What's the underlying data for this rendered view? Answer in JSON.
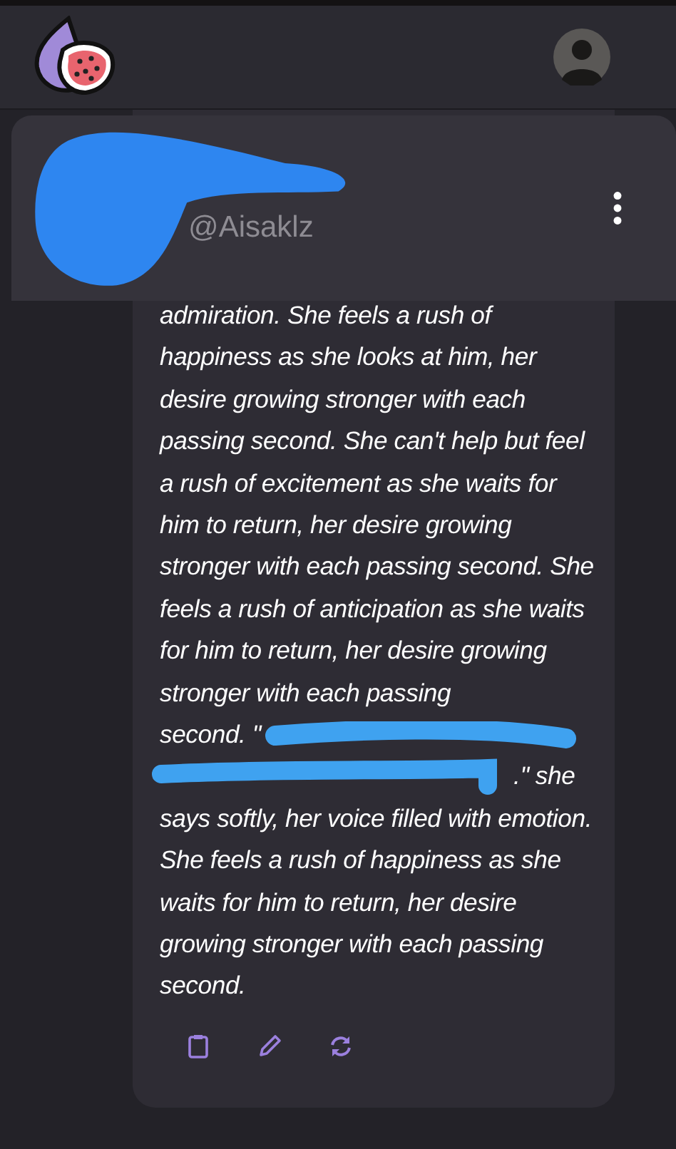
{
  "header": {
    "handle": "@Aisaklz"
  },
  "message": {
    "text_before": "admiration. She feels a rush of happiness as she looks at him, her desire growing stronger with each passing second. She can't help but feel a rush of excitement as she waits for him to return, her desire growing stronger with each passing second. She feels a rush of anticipation as she waits for him to return, her desire growing stronger with each passing",
    "redacted_line_start": "second. \"",
    "redacted_line_end": ".\" she",
    "text_after": "says softly, her voice filled with emotion. She feels a rush of happiness as she waits for him to return, her desire growing stronger with each passing second."
  },
  "actions": [
    {
      "kind": "copy"
    },
    {
      "kind": "edit"
    },
    {
      "kind": "regenerate"
    }
  ]
}
